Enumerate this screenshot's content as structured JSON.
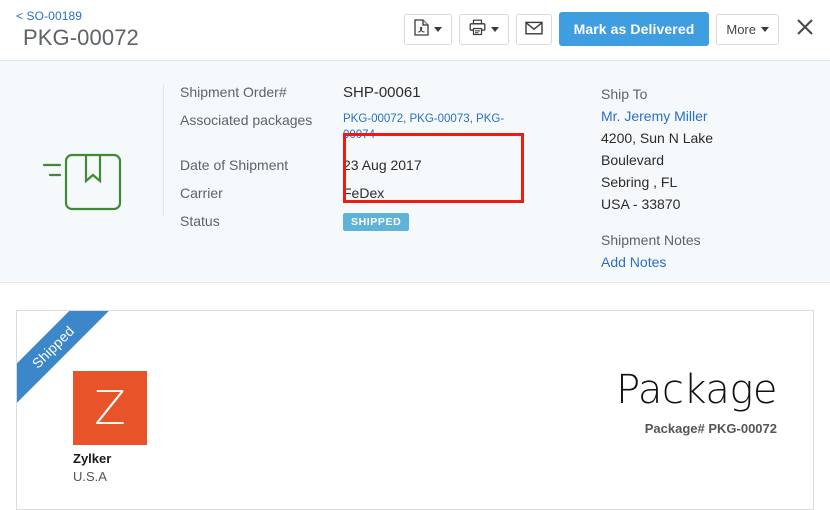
{
  "header": {
    "breadcrumb": "< SO-00189",
    "title": "PKG-00072",
    "toolbar": {
      "pdf_icon": "pdf-document-icon",
      "print_icon": "printer-icon",
      "email_icon": "envelope-icon",
      "primary_label": "Mark as Delivered",
      "more_label": "More",
      "close_icon": "close-icon"
    }
  },
  "info": {
    "package_icon": "package-box-icon",
    "fields": [
      {
        "label": "Shipment Order#",
        "value": "SHP-00061"
      },
      {
        "label": "Associated packages",
        "value": ""
      },
      {
        "label": "Date of Shipment",
        "value": "23 Aug 2017"
      },
      {
        "label": "Carrier",
        "value": "FeDex"
      },
      {
        "label": "Status",
        "value": "SHIPPED"
      }
    ],
    "associated_packages": [
      "PKG-00072",
      "PKG-00073",
      "PKG-00074"
    ],
    "associated_separator": ",",
    "status_badge": "SHIPPED",
    "status_badge_color": "#5fb3d9",
    "highlight_color": "#ee1b15"
  },
  "ship_to": {
    "heading": "Ship To",
    "name": "Mr. Jeremy Miller",
    "address_lines": [
      "4200, Sun N Lake",
      "Boulevard",
      "Sebring , FL",
      "USA - 33870"
    ],
    "notes_heading": "Shipment Notes",
    "notes_link": "Add Notes"
  },
  "document": {
    "ribbon_label": "Shipped",
    "ribbon_color": "#3c87ca",
    "logo_letter": "Z",
    "logo_color": "#e8542a",
    "org_name": "Zylker",
    "org_country": "U.S.A",
    "title": "Package",
    "subtitle": "Package# PKG-00072"
  }
}
